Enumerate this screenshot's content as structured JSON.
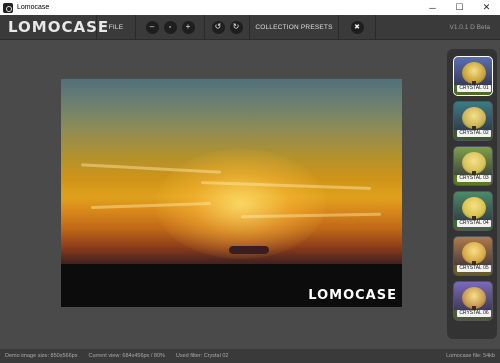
{
  "window": {
    "title": "Lomocase",
    "minimize": "─",
    "maximize": "☐",
    "close": "✕"
  },
  "toolbar": {
    "logo": "LOMOCASE",
    "file_label": "FILE",
    "zoom_out": "–",
    "zoom_fit": "▫",
    "zoom_in": "+",
    "rotate_left": "↺",
    "rotate_right": "↻",
    "presets_label": "COLLECTION PRESETS",
    "close_image": "✖",
    "version": "V1.0.1 D Beta"
  },
  "canvas": {
    "watermark": "LOMOCASE"
  },
  "presets": [
    {
      "label": "CRYSTAL 01",
      "sky": "#5b6fb0",
      "tree": "#c8a23a",
      "ground": "#4a6b2a",
      "active": true
    },
    {
      "label": "CRYSTAL 02",
      "sky": "#3e7a86",
      "tree": "#c9b456",
      "ground": "#3c5a30",
      "active": false
    },
    {
      "label": "CRYSTAL 03",
      "sky": "#7fa04a",
      "tree": "#d6c25a",
      "ground": "#5a7a28",
      "active": false
    },
    {
      "label": "CRYSTAL 04",
      "sky": "#4c8a6a",
      "tree": "#d8c34c",
      "ground": "#3e6a34",
      "active": false
    },
    {
      "label": "CRYSTAL 05",
      "sky": "#b07a4a",
      "tree": "#d9a848",
      "ground": "#6a5a30",
      "active": false
    },
    {
      "label": "CRYSTAL 06",
      "sky": "#7a6ab8",
      "tree": "#c89850",
      "ground": "#4e5a3a",
      "active": false
    }
  ],
  "status": {
    "demo_size": "Demo image size: 850x566px",
    "current_view": "Current view: 684x456px / 80%",
    "used_filter": "Used filter: Crystal 02",
    "file_size": "Lomocase file: 54kb"
  }
}
